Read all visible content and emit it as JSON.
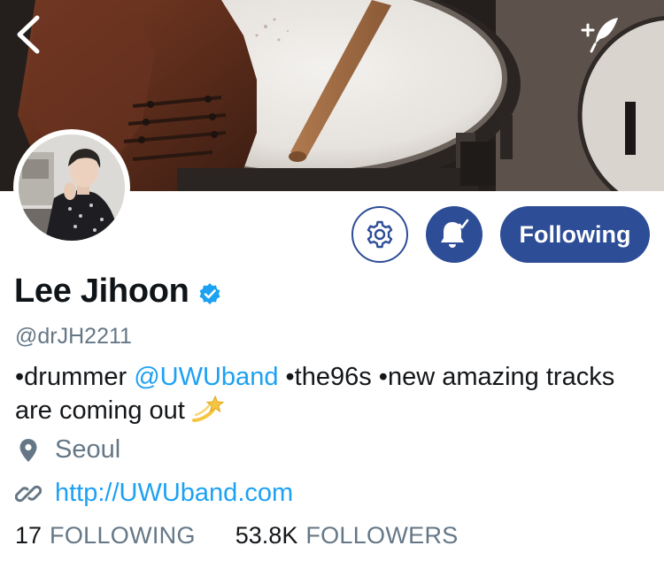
{
  "header": {
    "back_icon": "chevron-left-icon",
    "compose_icon": "compose-feather-icon"
  },
  "profile": {
    "display_name": "Lee Jihoon",
    "verified": true,
    "handle": "@drJH2211",
    "bio": {
      "part1": "•drummer ",
      "mention": "@UWUband",
      "part2": " •the96s •new amazing tracks are coming out",
      "emoji": "dizzy-icon"
    },
    "location": "Seoul",
    "website": "http://UWUband.com"
  },
  "actions": {
    "settings_icon": "gear-icon",
    "notifications_icon": "bell-check-icon",
    "follow_label": "Following"
  },
  "stats": {
    "following_count": "17",
    "following_label": "FOLLOWING",
    "followers_count": "53.8K",
    "followers_label": "FOLLOWERS"
  },
  "colors": {
    "accent": "#2d4d96",
    "link": "#1da1f2",
    "secondary_text": "#657786",
    "verified": "#1da1f2"
  }
}
